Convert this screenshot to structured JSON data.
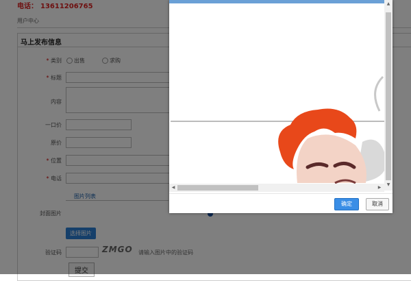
{
  "header": {
    "phone_label": "电话：",
    "phone_number": "13611206765"
  },
  "breadcrumb_text": "用户中心",
  "panel": {
    "title": "马上发布信息"
  },
  "form": {
    "type_label": "类别",
    "type_options": [
      "出售",
      "求购"
    ],
    "title_label": "标题",
    "content_label": "内容",
    "price_label": "一口价",
    "original_price_label": "原价",
    "location_label": "位置",
    "phone_label": "电话",
    "pic_tab_label": "图片列表",
    "cover_label": "封面图片",
    "select_pic_button": "选择图片",
    "captcha_label": "验证码",
    "captcha_image_text": "ZMGO",
    "captcha_hint": "请输入图片中的验证码",
    "submit_button": "提交"
  },
  "dialog": {
    "ok_button": "确定",
    "cancel_button": "取消",
    "close_icon": "close-icon"
  },
  "colors": {
    "accent": "#2a7fd4",
    "phone": "#d22222",
    "hair": "#e8481a"
  }
}
